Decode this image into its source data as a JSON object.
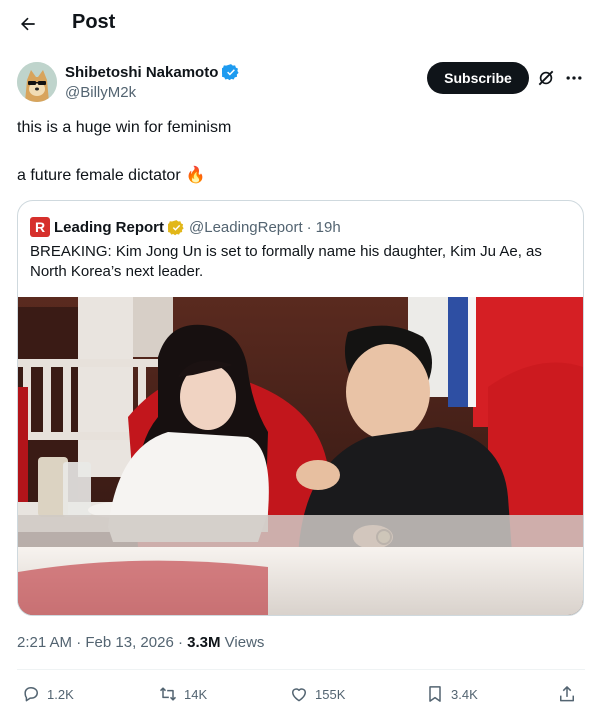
{
  "header": {
    "title": "Post"
  },
  "author": {
    "name": "Shibetoshi Nakamoto",
    "handle": "@BillyM2k",
    "verified": true,
    "verified_color": "#1d9bf0"
  },
  "actions_top": {
    "subscribe_label": "Subscribe"
  },
  "tweet": {
    "line1": "this is a huge win for feminism",
    "line2": "a future female dictator",
    "emoji": "🔥"
  },
  "quote": {
    "logo_letter": "R",
    "name": "Leading Report",
    "handle": "@LeadingReport",
    "separator": "·",
    "time": "19h",
    "verified_color": "#e2b719",
    "text": "BREAKING: Kim Jong Un is set to formally name his daughter, Kim Ju Ae, as North Korea’s next leader."
  },
  "meta": {
    "time": "2:21 AM",
    "date": "Feb 13, 2026",
    "separator": "·",
    "views": "3.3M",
    "views_label": "Views"
  },
  "engagement": {
    "replies": "1.2K",
    "reposts": "14K",
    "likes": "155K",
    "bookmarks": "3.4K"
  },
  "icons": [
    "back-arrow-icon",
    "verified-badge-icon",
    "grok-icon",
    "more-icon",
    "reply-icon",
    "repost-icon",
    "like-icon",
    "bookmark-icon",
    "share-icon"
  ],
  "colors": {
    "text": "#0f1419",
    "secondary": "#536471",
    "accent": "#1d9bf0",
    "brand_red": "#d6302c"
  }
}
